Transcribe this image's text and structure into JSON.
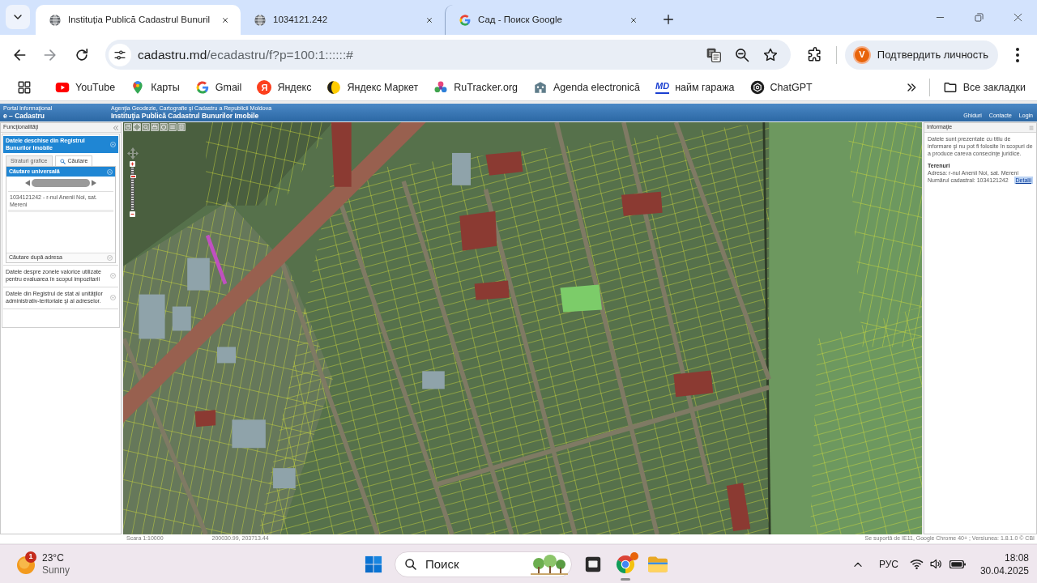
{
  "browser": {
    "tabs": [
      {
        "kind": "globe",
        "title": "Instituția Publică Cadastrul Bunuril",
        "selected": true
      },
      {
        "kind": "globe",
        "title": "1034121.242",
        "selected": false
      },
      {
        "kind": "google",
        "title": "Сад - Поиск Google",
        "selected": false
      }
    ],
    "address": {
      "host": "cadastru.md",
      "path": "/ecadastru/f?p=100:1::::::#"
    },
    "profile": {
      "initial": "V",
      "label": "Подтвердить личность"
    },
    "bookmarks": [
      {
        "kind": "youtube",
        "label": "YouTube"
      },
      {
        "kind": "maps",
        "label": "Карты"
      },
      {
        "kind": "google",
        "label": "Gmail"
      },
      {
        "kind": "glyph",
        "glyph": "Я",
        "label": "Яндекс"
      },
      {
        "kind": "market",
        "label": "Яндекс Маркет"
      },
      {
        "kind": "flower",
        "label": "RuTracker.org"
      },
      {
        "kind": "building",
        "label": "Agenda electronică"
      },
      {
        "kind": "monogram",
        "glyph": "MD",
        "label": "найм гаража"
      },
      {
        "kind": "hexagon",
        "label": "ChatGPT"
      }
    ],
    "all_bookmarks": "Все закладки"
  },
  "page": {
    "header": {
      "portal": "Portal informaţional",
      "brand": "e – Cadastru",
      "agency": "Agenţia Geodezie, Cartografie şi Cadastru a Republicii Moldova",
      "institution": "Instituţia Publică Cadastrul Bunurilor Imobile",
      "links": [
        "Ghiduri",
        "Contacte",
        "Login"
      ]
    },
    "sidebar": {
      "title": "Funcţionalităţi",
      "sections": [
        {
          "title": "Datele deschise din Registrul Bunurilor Imobile",
          "expanded": true,
          "tabs": [
            {
              "label": "Straturi grafice",
              "selected": false
            },
            {
              "label": "Căutare",
              "selected": true
            }
          ],
          "panels": [
            {
              "title": "Căutare universală",
              "expanded": true,
              "results": [
                "1034121242 - r-nul Anenii Noi, sat. Mereni"
              ]
            },
            {
              "title": "Căutare după adresa",
              "expanded": false
            }
          ]
        },
        {
          "title": "Datele despre zonele valorice utilizate pentru evaluarea în scopul impozitarii",
          "expanded": false
        },
        {
          "title": "Datele din Registrul de stat al unităţilor administrativ-teritoriale şi al adreselor.",
          "expanded": false
        }
      ]
    },
    "map": {
      "zoom": {
        "level": 0.8
      }
    },
    "info_panel": {
      "title": "Informaţie",
      "notice": "Datele sunt prezentate cu titlu de informare şi nu pot fi folosite în scopuri de a produce careva consecinţe juridice.",
      "result": {
        "category": "Terenuri",
        "address": "Adresa: r-nul Anenii Noi, sat. Mereni",
        "cadastral_number": "Numărul cadastral: 1034121242",
        "details": "Detalii"
      }
    },
    "status_bar": {
      "scale": "Scara 1:10000",
      "coordinates": "200030.99, 203713.44",
      "support": "Se suportă de IE11, Google Chrome 40+ ; Versiunea: 1.8.1.0 © CBI"
    }
  },
  "taskbar": {
    "weather": {
      "badge": "1",
      "temperature": "23°C",
      "condition": "Sunny"
    },
    "search": {
      "placeholder": "Поиск"
    },
    "language": "РУС",
    "time": "18:08",
    "date": "30.04.2025"
  }
}
